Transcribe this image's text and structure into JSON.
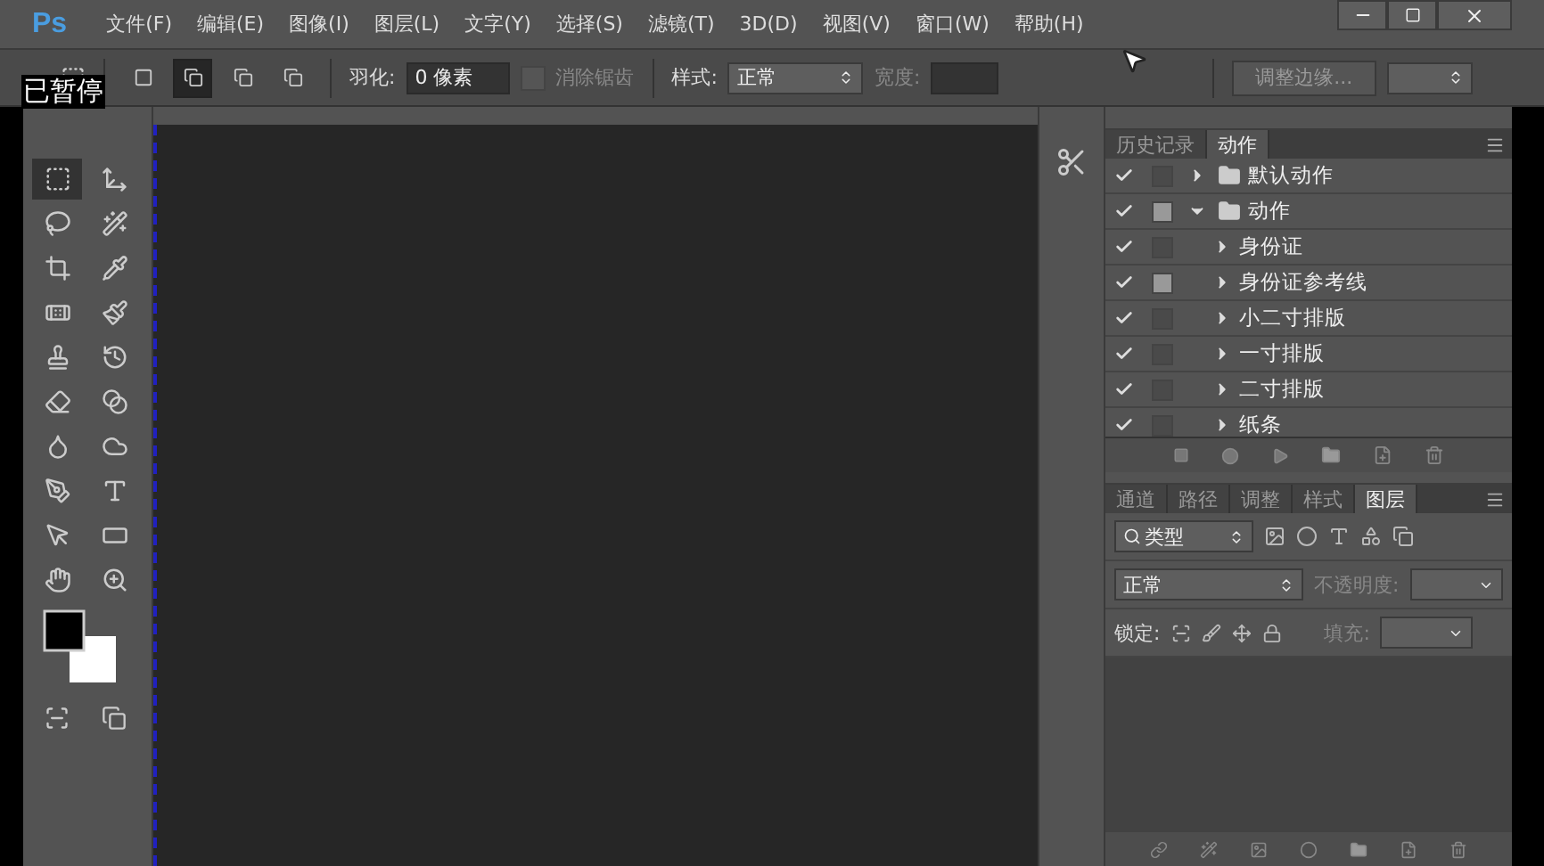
{
  "overlay_label": "已暂停",
  "logo": "Ps",
  "menu": [
    "文件(F)",
    "编辑(E)",
    "图像(I)",
    "图层(L)",
    "文字(Y)",
    "选择(S)",
    "滤镜(T)",
    "3D(D)",
    "视图(V)",
    "窗口(W)",
    "帮助(H)"
  ],
  "options": {
    "modes": [
      {
        "selected": false
      },
      {
        "selected": true
      },
      {
        "selected": false
      },
      {
        "selected": false
      }
    ],
    "feather_label": "羽化:",
    "feather_value": "0 像素",
    "antialias": {
      "label": "消除锯齿",
      "checked": false,
      "disabled": true
    },
    "style_label": "样式:",
    "style_value": "正常",
    "width_label": "宽度:",
    "refine_button": "调整边缘..."
  },
  "tools": [
    {
      "selected": true
    },
    {
      "selected": false
    },
    {
      "selected": false
    },
    {
      "selected": false
    },
    {
      "selected": false
    },
    {
      "selected": false
    },
    {
      "selected": false
    },
    {
      "selected": false
    },
    {
      "selected": false
    },
    {
      "selected": false
    },
    {
      "selected": false
    },
    {
      "selected": false
    },
    {
      "selected": false
    },
    {
      "selected": false
    },
    {
      "selected": false
    },
    {
      "selected": false
    },
    {
      "selected": false
    },
    {
      "selected": false
    },
    {
      "selected": false
    },
    {
      "selected": false
    }
  ],
  "actions_panel": {
    "tabs": [
      {
        "label": "历史记录",
        "selected": false
      },
      {
        "label": "动作",
        "selected": true
      }
    ],
    "items": [
      {
        "name": "默认动作",
        "kind": "set",
        "checked": true,
        "dialog": false,
        "expanded": false
      },
      {
        "name": "动作",
        "kind": "set",
        "checked": true,
        "dialog": true,
        "expanded": true,
        "children": [
          {
            "name": "身份证",
            "kind": "action",
            "checked": true,
            "dialog": false,
            "expanded": false
          },
          {
            "name": "身份证参考线",
            "kind": "action",
            "checked": true,
            "dialog": true,
            "expanded": false
          },
          {
            "name": "小二寸排版",
            "kind": "action",
            "checked": true,
            "dialog": false,
            "expanded": false
          },
          {
            "name": "一寸排版",
            "kind": "action",
            "checked": true,
            "dialog": false,
            "expanded": false
          },
          {
            "name": "二寸排版",
            "kind": "action",
            "checked": true,
            "dialog": false,
            "expanded": false
          },
          {
            "name": "纸条",
            "kind": "action",
            "checked": true,
            "dialog": false,
            "expanded": false
          }
        ]
      }
    ]
  },
  "layers_panel": {
    "tabs": [
      {
        "label": "通道",
        "selected": false
      },
      {
        "label": "路径",
        "selected": false
      },
      {
        "label": "调整",
        "selected": false
      },
      {
        "label": "样式",
        "selected": false
      },
      {
        "label": "图层",
        "selected": true
      }
    ],
    "filter_value": "类型",
    "blend_value": "正常",
    "opacity_label": "不透明度:",
    "lock_label": "锁定:",
    "fill_label": "填充:"
  }
}
